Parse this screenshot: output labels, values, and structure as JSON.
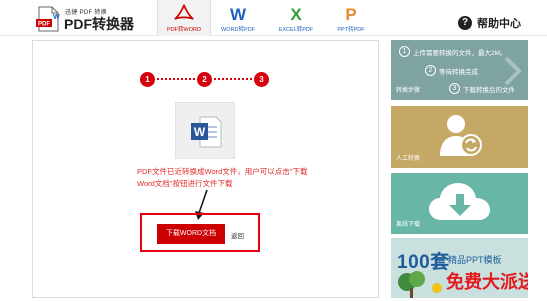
{
  "header": {
    "logo": {
      "small": "迅捷 PDF 转换",
      "title": "PDF转换器",
      "doc_badge": "PDF"
    },
    "tabs": [
      {
        "label": "PDF转WORD",
        "icon": "acrobat-icon",
        "color": "#cc0000",
        "active": true
      },
      {
        "label": "WORD转PDF",
        "icon": "word-w-icon",
        "glyph": "W",
        "color": "#1e5fbf",
        "active": false
      },
      {
        "label": "EXCEL转PDF",
        "icon": "excel-x-icon",
        "glyph": "X",
        "color": "#2e9d3a",
        "active": false
      },
      {
        "label": "PPT转PDF",
        "icon": "ppt-p-icon",
        "glyph": "P",
        "color": "#e8892b",
        "active": false
      }
    ],
    "help": {
      "icon": "question-icon",
      "glyph": "?",
      "label": "帮助中心"
    }
  },
  "main": {
    "steps": [
      "1",
      "2",
      "3"
    ],
    "doc_icon": "word-document-icon",
    "message": "PDF文件已近转换成Word文件，用户可以点击\"下载Word文档\"按钮进行文件下载",
    "download_button": "下载WORD文档",
    "back_link": "返回",
    "accent": "#d6000f"
  },
  "sidebar": {
    "steps_card": {
      "steps": [
        {
          "num": "1",
          "text": "上传需要转换的文件，最大2M。"
        },
        {
          "num": "2",
          "text": "等待转换完成"
        },
        {
          "num": "3",
          "text": "下载转换后的文件"
        }
      ],
      "caption": "转换步骤",
      "color": "#7fa3a1"
    },
    "manual_card": {
      "caption": "人工转换",
      "icon": "user-sync-icon",
      "color": "#c6a866"
    },
    "download_card": {
      "caption": "离线下载",
      "icon": "cloud-download-icon",
      "color": "#67b6a6"
    },
    "ppt_ad": {
      "big": "100套",
      "sub": "精品PPT模板",
      "banner": "免费大派送",
      "color": "#c9e0df"
    }
  }
}
